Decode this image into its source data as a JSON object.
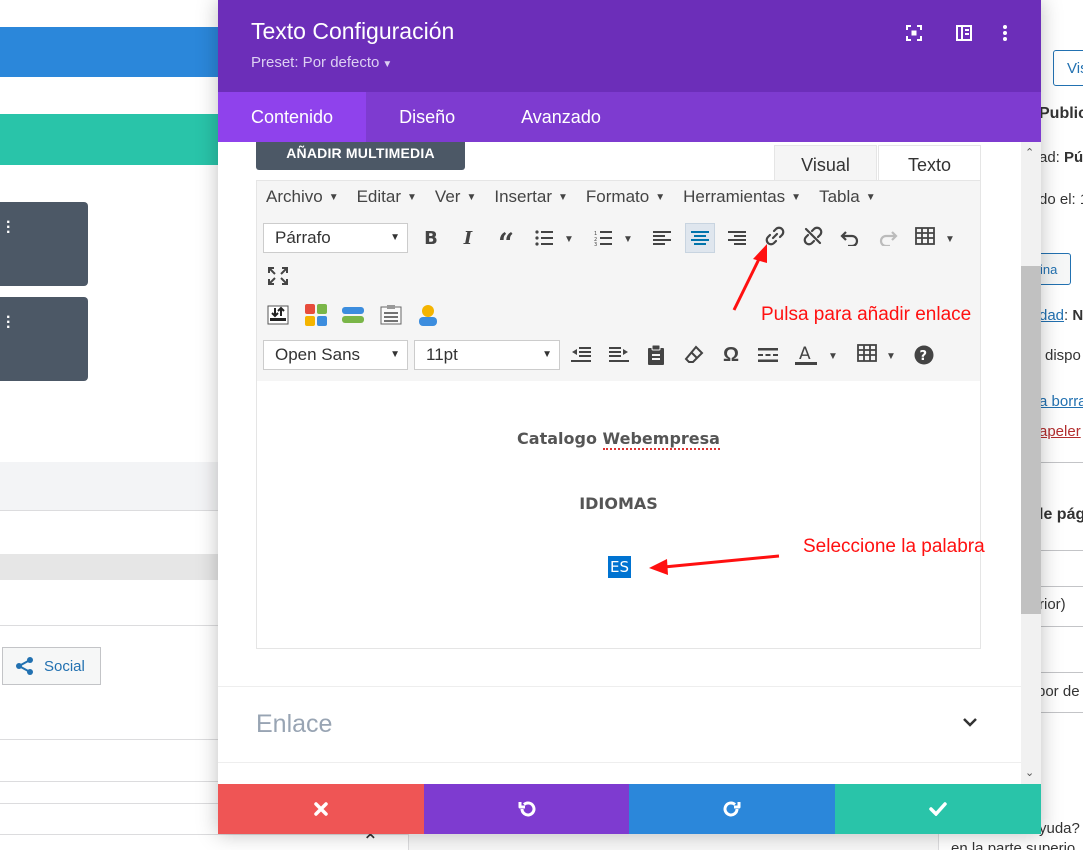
{
  "background": {
    "social_label": "Social",
    "right_panel": {
      "button_label": "Vis",
      "publish_label": "Public",
      "visibility_label": "ad:",
      "visibility_value": "Pú",
      "published_on": "do el: 1",
      "link_button": "ina",
      "status_label": "dad",
      "status_value": "Nc",
      "available": "dispo",
      "delete_link": "a borra",
      "trash_link": "apeler",
      "section_title": "le pág",
      "previous": "rior)",
      "default": "por de"
    },
    "bottom_help_line1": "yuda?",
    "bottom_help_line2": "en la parte superio"
  },
  "modal": {
    "title": "Texto Configuración",
    "preset_label": "Preset: Por defecto",
    "tabs": [
      {
        "label": "Contenido",
        "active": true
      },
      {
        "label": "Diseño",
        "active": false
      },
      {
        "label": "Avanzado",
        "active": false
      }
    ],
    "add_media_label": "AÑADIR MULTIMEDIA",
    "editor_tabs": {
      "visual": "Visual",
      "texto": "Texto"
    },
    "menus": [
      "Archivo",
      "Editar",
      "Ver",
      "Insertar",
      "Formato",
      "Herramientas",
      "Tabla"
    ],
    "format_select": "Párrafo",
    "font_select": "Open Sans",
    "size_select": "11pt",
    "content": {
      "line1_prefix": "Catalogo ",
      "line1_word": "Webempresa",
      "line2": "IDIOMAS",
      "selected_word": "ES"
    },
    "annotations": {
      "link_hint": "Pulsa para añadir enlace",
      "select_hint": "Seleccione la palabra"
    },
    "link_section_label": "Enlace",
    "accent_colors": {
      "header": "#6c2eb9",
      "tabs": "#7e3bd0",
      "cancel": "#ef5555",
      "undo": "#7e3bd0",
      "redo": "#2b87da",
      "save": "#29c4a9"
    }
  }
}
